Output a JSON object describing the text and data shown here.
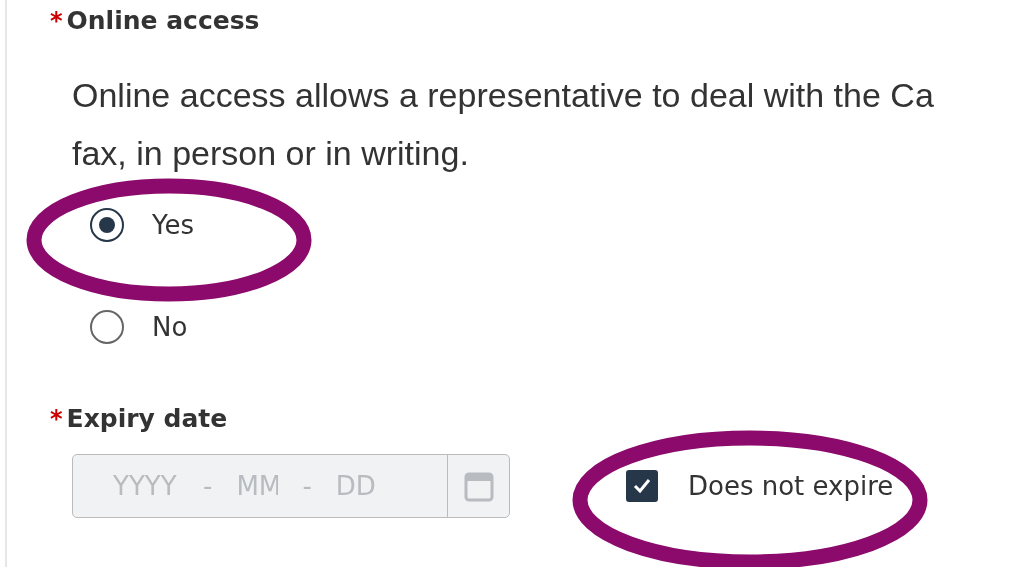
{
  "online_access": {
    "label": "Online access",
    "required_mark": "*",
    "description": "Online access allows a representative to deal with the Ca\nfax, in person or in writing.",
    "options": [
      {
        "label": "Yes",
        "selected": true
      },
      {
        "label": "No",
        "selected": false
      }
    ]
  },
  "expiry_date": {
    "label": "Expiry date",
    "required_mark": "*",
    "disabled": true,
    "segments": [
      {
        "kind": "part",
        "placeholder": "YYYY"
      },
      {
        "kind": "separator",
        "text": "-"
      },
      {
        "kind": "part",
        "placeholder": "MM"
      },
      {
        "kind": "separator",
        "text": "-"
      },
      {
        "kind": "part",
        "placeholder": "DD"
      }
    ],
    "no_expiry": {
      "label": "Does not expire",
      "checked": true
    }
  }
}
